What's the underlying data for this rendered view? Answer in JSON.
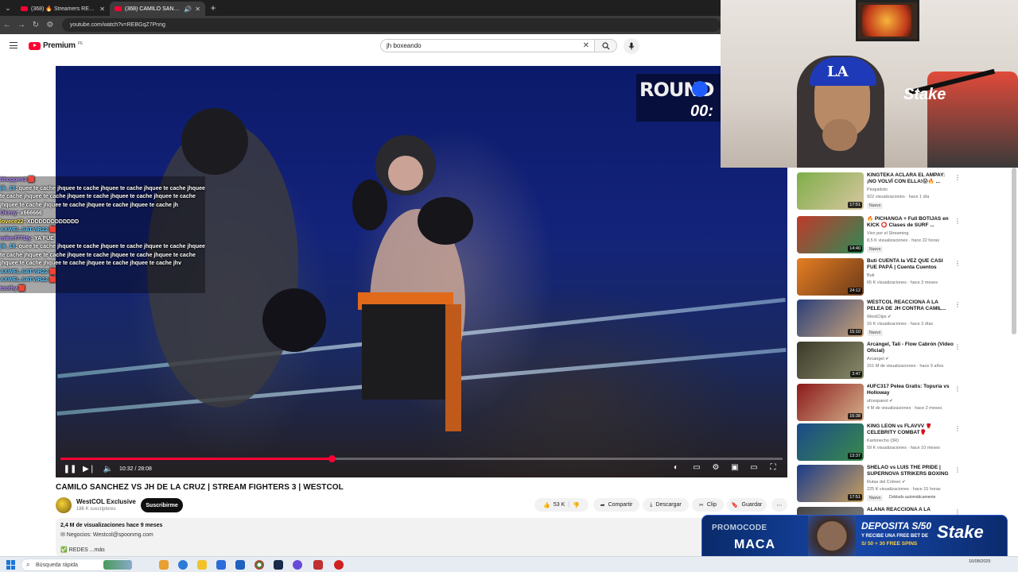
{
  "browser": {
    "tabs": [
      {
        "title": "(368) 🔥 Streamers REACCIONA",
        "active": false
      },
      {
        "title": "(368) CAMILO SANCHEZ VS",
        "active": true
      }
    ],
    "url": "youtube.com/watch?v=REBGqZ7Pnng"
  },
  "youtube": {
    "logo_text": "Premium",
    "logo_country": "PE",
    "search_value": "jh boxeando"
  },
  "player": {
    "round_text": "ROUND 1",
    "clock_text": "00:",
    "timecode": "10:32 / 28:08",
    "progress_fraction": 0.375
  },
  "chat": [
    {
      "user": "bhoppen3",
      "text": ""
    },
    {
      "user": "jlk_16",
      "text": ": quee te cache jhquee te cache jhquee te cache jhquee te cache jhquee te cache jhquee te cache jhquee te cache jhquee te cache jhquee te cache jhquee te cache jhquee te cache jhquee te cache jhquee te cache jh"
    },
    {
      "user": "Okeny",
      "text": ": x666666"
    },
    {
      "user": "lovece22",
      "text": ": XDDDDDDDDDDDD"
    },
    {
      "user": "AXWEL.SATVIR22",
      "text": ""
    },
    {
      "user": "mikerf771ty",
      "text": ": YA FUE"
    },
    {
      "user": "jlk_16",
      "text": ": quee te cache jhquee te cache jhquee te cache jhquee te cache jhquee te cache jhquee te cache jhquee te cache jhquee te cache jhquee te cache jhquee te cache jhquee te cache jhquee te cache jhquee te cache jhv"
    },
    {
      "user": "AXWEL.SATVIR22",
      "text": ""
    },
    {
      "user": "AXWEL.SATVIR22",
      "text": ""
    },
    {
      "user": "toothy",
      "text": ""
    }
  ],
  "video": {
    "title": "CAMILO SANCHEZ VS JH DE LA CRUZ | STREAM FIGHTERS 3 | WESTCOL",
    "channel": "WestCOL Exclusive",
    "subscribers": "186 K suscriptores",
    "subscribe_label": "Suscribirme",
    "likes": "53 K",
    "share_label": "Compartir",
    "download_label": "Descargar",
    "clip_label": "Clip",
    "save_label": "Guardar",
    "views": "2,4 M de visualizaciones  hace 9 meses",
    "contact": "✉ Negocios: Westcol@spoonmg.com",
    "redes": "✅ REDES  ...más"
  },
  "recommendations": [
    {
      "title": "KINGTEKA ACLARA EL AMPAY: ¡NO VOLVÍ CON ELLA!😱🔥 ...",
      "channel": "Pioquidoto",
      "meta": "922 visualizaciones · hace 1 día",
      "badge": "Nuevo",
      "duration": "17:51",
      "colors": [
        "#7fae4a",
        "#d8c6a0"
      ]
    },
    {
      "title": "🔥 PICHANGA + Full  BOTIJAS en KICK  ⭕ Clases de SURF ...",
      "channel": "Vivo por el Streaming",
      "meta": "8,5 K visualizaciones · hace 22 horas",
      "badge": "Nuevo",
      "duration": "14:40",
      "colors": [
        "#c0392b",
        "#2e8b57"
      ]
    },
    {
      "title": "Buti CUENTA la VEZ QUE CASI FUE PAPÁ | Cuenta Cuentos",
      "channel": "Buti",
      "meta": "65 K visualizaciones · hace 3 meses",
      "badge": "",
      "duration": "24:12",
      "colors": [
        "#e67e22",
        "#6b3a1a"
      ]
    },
    {
      "title": "WESTCOL REACCIONA A LA PELEA DE JH CONTRA CAMIL...",
      "channel": "WestClips ✔",
      "meta": "16 K visualizaciones · hace 3 días",
      "badge": "Nuevo",
      "duration": "15:10",
      "colors": [
        "#2a3f7a",
        "#c9a27a"
      ]
    },
    {
      "title": "Arcángel, Tali - Flow Cabrón (Video Oficial)",
      "channel": "Arcangel ✔",
      "meta": "151 M de visualizaciones · hace 9 años",
      "badge": "",
      "duration": "3:47",
      "colors": [
        "#3a3a2a",
        "#8a8a6a"
      ]
    },
    {
      "title": "#UFC317 Pelea Gratis: Topuria vs Holloway",
      "channel": "ufcespanol ✔",
      "meta": "4 M de visualizaciones · hace 2 meses",
      "badge": "",
      "duration": "16:38",
      "colors": [
        "#8b1a1a",
        "#d4b08c"
      ]
    },
    {
      "title": "KING LEON vs FLAVVV 🥊 CELEBRITY COMBAT🥊",
      "channel": "Karlonecho (3R)",
      "meta": "59 K visualizaciones · hace 10 meses",
      "badge": "",
      "duration": "13:37",
      "colors": [
        "#1a4a8a",
        "#3a8a4a"
      ]
    },
    {
      "title": "SHELAO vs LUIS THE PRIDE | SUPERNOVA STRIKERS BOXING",
      "channel": "Rutas del Crimen ✔",
      "meta": "225 K visualizaciones · hace 15 horas",
      "badge": "Nuevo",
      "badge2": "Doblado automáticamente",
      "duration": "17:51",
      "colors": [
        "#1a3a8a",
        "#c8a060"
      ]
    },
    {
      "title": "ALANA REACCIONA A LA",
      "channel": "",
      "meta": "",
      "badge": "",
      "duration": "",
      "colors": [
        "#444",
        "#888"
      ]
    }
  ],
  "ad": {
    "promo_top": "PROMOCODE",
    "promo_code": "MACA",
    "line1": "DEPOSITA S/50",
    "line2": "Y RECIBE UNA FREE BET DE",
    "line3": "S/ 50 + 30 FREE SPINS",
    "brand": "Stake"
  },
  "taskbar": {
    "search_placeholder": "Búsqueda rápida",
    "date": "16/08/2025"
  }
}
